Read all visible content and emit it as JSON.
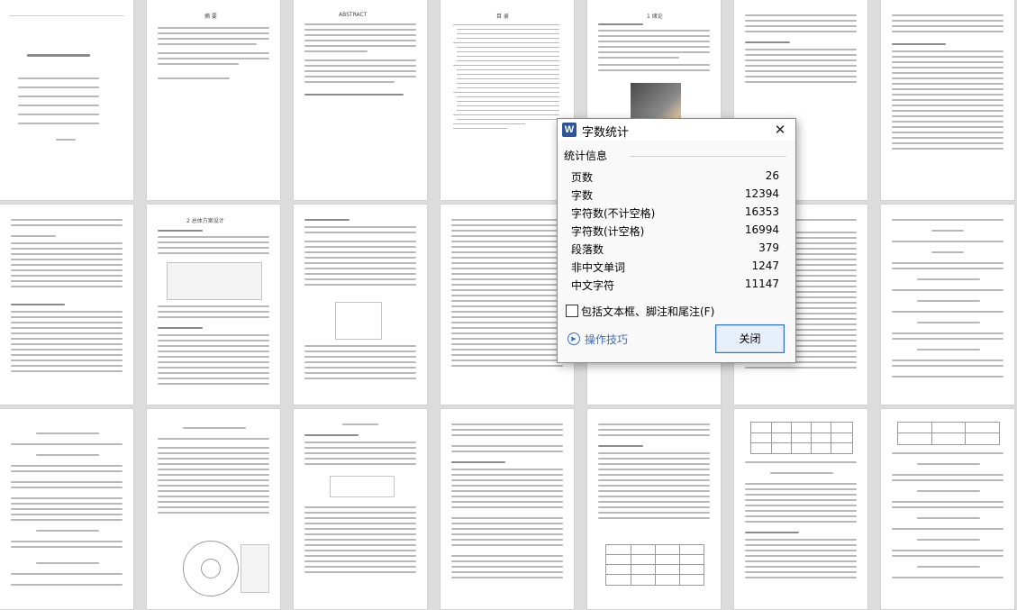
{
  "dialog": {
    "app_icon": "W",
    "title": "字数统计",
    "close_glyph": "✕",
    "group_label": "统计信息",
    "stats": [
      {
        "label": "页数",
        "value": "26"
      },
      {
        "label": "字数",
        "value": "12394"
      },
      {
        "label": "字符数(不计空格)",
        "value": "16353"
      },
      {
        "label": "字符数(计空格)",
        "value": "16994"
      },
      {
        "label": "段落数",
        "value": "379"
      },
      {
        "label": "非中文单词",
        "value": "1247"
      },
      {
        "label": "中文字符",
        "value": "11147"
      }
    ],
    "checkbox": {
      "label": "包括文本框、脚注和尾注(F)",
      "checked": false
    },
    "tips_label": "操作技巧",
    "close_button": "关闭"
  },
  "pages": {
    "page2_heading": "摘 要",
    "page3_heading": "ABSTRACT",
    "page4_heading": "目 录",
    "page5_heading": "1 绪论",
    "page10_heading": "2 总体方案设计"
  },
  "icons": {
    "app": "word-icon",
    "close": "close-icon",
    "tips": "play-circle-icon"
  },
  "colors": {
    "background": "#dcdcdc",
    "accent": "#2b579a",
    "link": "#3a6fc4",
    "button_border": "#2f73c8"
  }
}
